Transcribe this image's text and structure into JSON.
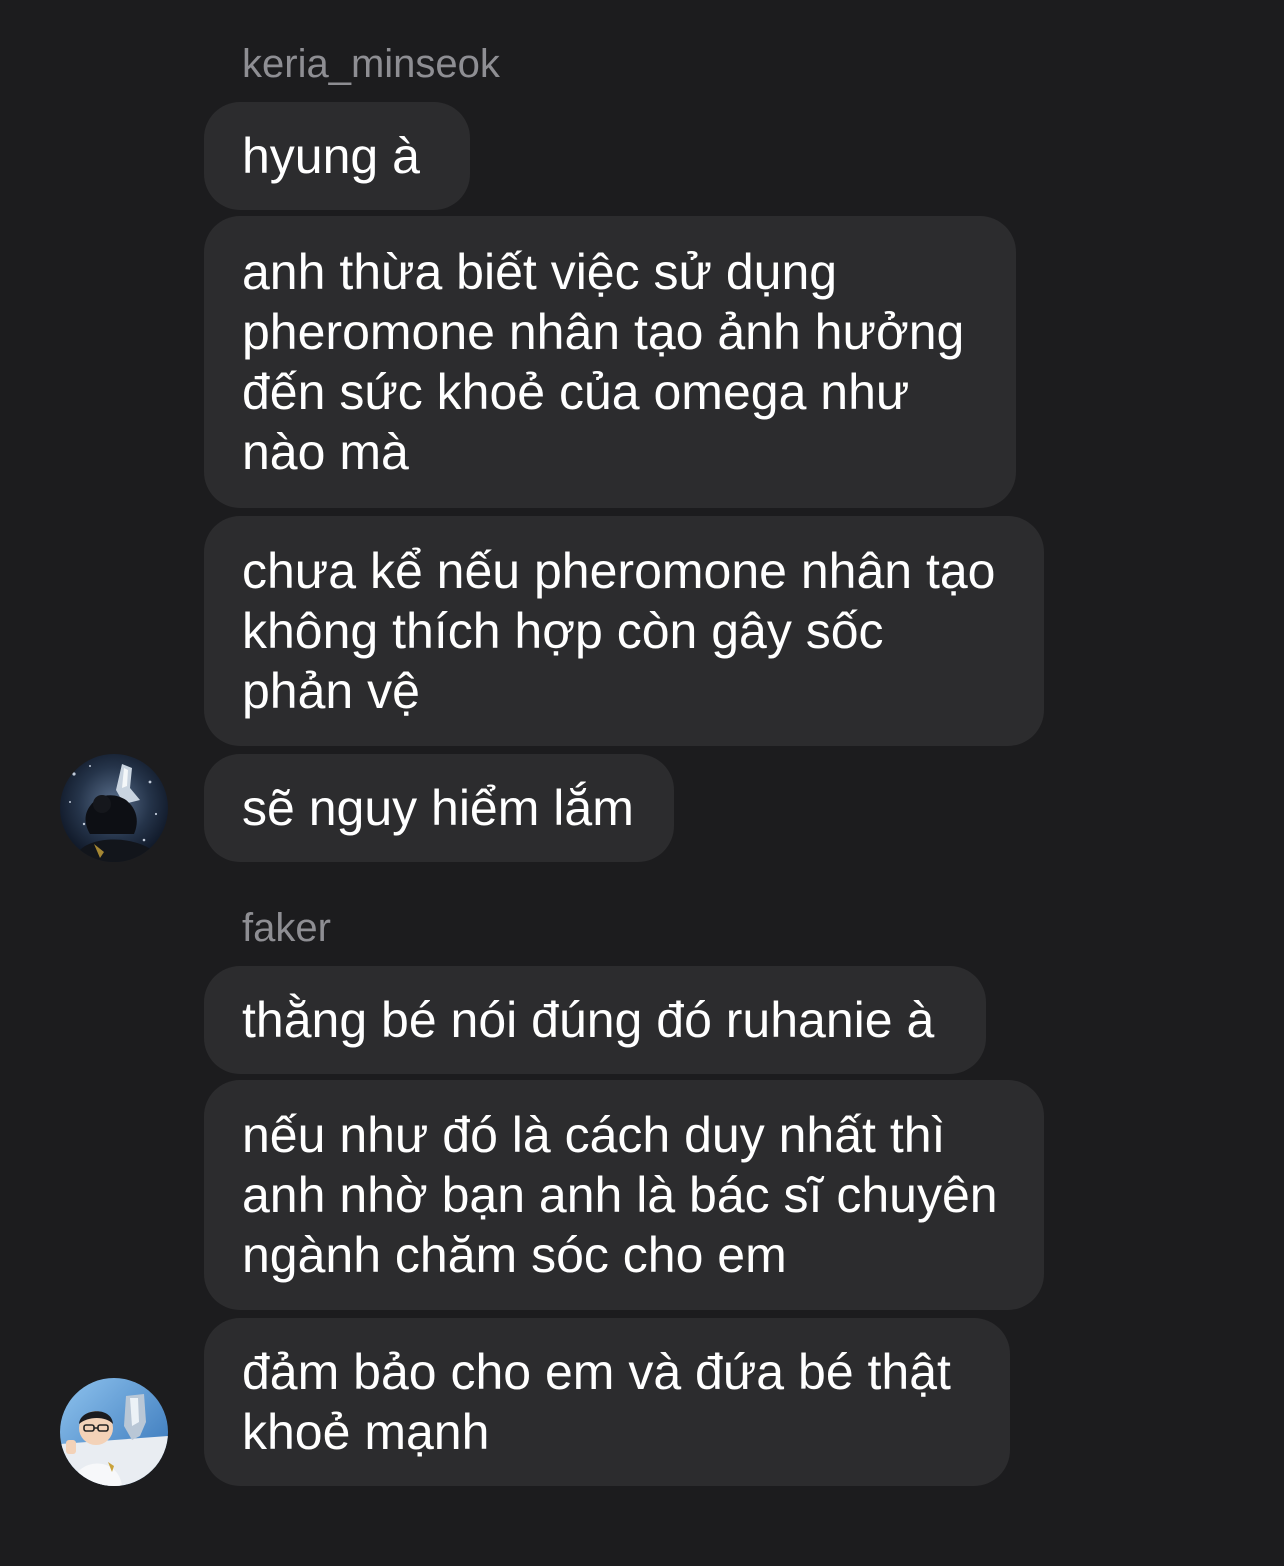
{
  "groups": [
    {
      "sender": "keria_minseok",
      "avatar_icon": "user-avatar-trophy-dark",
      "messages": [
        "hyung à",
        "anh thừa biết việc sử dụng\npheromone nhân tạo ảnh hưởng\nđến sức khoẻ của omega như\nnào mà",
        "chưa kể nếu pheromone nhân tạo\nkhông thích hợp còn gây sốc\nphản vệ",
        "sẽ nguy hiểm lắm"
      ]
    },
    {
      "sender": "faker",
      "avatar_icon": "user-avatar-trophy-light",
      "messages": [
        "thằng bé nói đúng đó ruhanie à",
        "nếu như đó là cách duy nhất thì\nanh nhờ bạn anh là bác sĩ chuyên\nngành chăm sóc cho em",
        "đảm bảo cho em và đứa bé thật\nkhoẻ mạnh"
      ]
    }
  ],
  "colors": {
    "background": "#1c1c1e",
    "bubble": "#2c2c2e",
    "text": "#ffffff",
    "sender_name": "#8e8e93"
  }
}
